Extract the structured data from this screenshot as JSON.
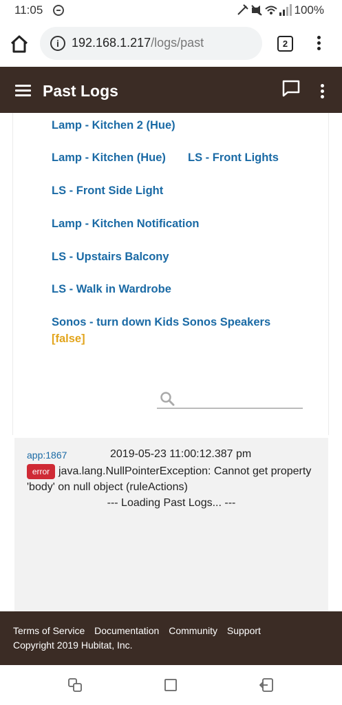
{
  "status": {
    "time": "11:05",
    "battery": "100%"
  },
  "browser": {
    "url_host": "192.168.1.217",
    "url_path": "/logs/past",
    "tab_count": "2"
  },
  "header": {
    "title": "Past Logs"
  },
  "devices": [
    {
      "label": "Lamp - Kitchen 2 (Hue)"
    },
    {
      "label": "Lamp - Kitchen (Hue)"
    },
    {
      "label": "LS - Front Lights"
    },
    {
      "label": "LS - Front Side Light"
    },
    {
      "label": "Lamp - Kitchen Notification"
    },
    {
      "label": "LS - Upstairs Balcony"
    },
    {
      "label": "LS - Walk in Wardrobe"
    },
    {
      "label": "Sonos - turn down Kids Sonos Speakers"
    }
  ],
  "false_tag": "[false]",
  "search": {
    "placeholder": ""
  },
  "log": {
    "app": "app:1867",
    "timestamp": "2019-05-23 11:00:12.387 pm",
    "level": "error",
    "message": "java.lang.NullPointerException: Cannot get property 'body' on null object (ruleActions)",
    "loading": "--- Loading Past Logs... ---"
  },
  "footer": {
    "links": [
      "Terms of Service",
      "Documentation",
      "Community",
      "Support"
    ],
    "copyright": "Copyright 2019 Hubitat, Inc."
  },
  "colors": {
    "header_bg": "#3b2c25",
    "link": "#1a6aa5",
    "false_tag": "#e2a41b",
    "error_badge": "#cf2a35"
  },
  "icons": [
    "dnd-icon",
    "home-icon",
    "info-icon",
    "menu-icon",
    "chat-icon",
    "more-vert-icon",
    "search-icon",
    "recents-icon",
    "home-square-icon",
    "back-icon"
  ]
}
